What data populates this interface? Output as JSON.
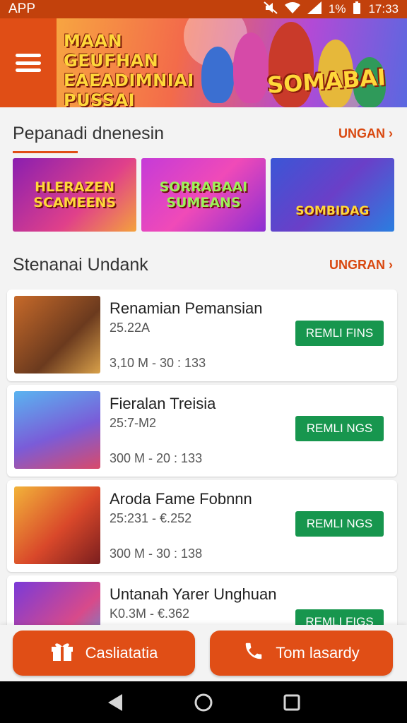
{
  "status_bar": {
    "app_label": "APP",
    "time": "17:33",
    "battery_text": "1%"
  },
  "hero": {
    "title": "MAAN GEUFHAN EAEADIMNIAI PUSSAI TACR!!",
    "logo": "SOMABAI"
  },
  "section1": {
    "title": "Pepanadi dnenesin",
    "link": "UNGAN",
    "cards": [
      {
        "label": "HLERAZEN SCAMEENS"
      },
      {
        "label": "SORRABAAI SUMEANS"
      },
      {
        "label": "SOMBIDAG"
      }
    ]
  },
  "section2": {
    "title": "Stenanai Undank",
    "link": "UNGRAN"
  },
  "list": [
    {
      "title": "Renamian Pemansian",
      "subtitle": "25.22A",
      "meta": "3,10 M - 30 : 133",
      "button": "REMLI FINS"
    },
    {
      "title": "Fieralan Treisia",
      "subtitle": "25:7-M2",
      "meta": "300 M - 20 : 133",
      "button": "REMLI NGS"
    },
    {
      "title": "Aroda Fame Fobnnn",
      "subtitle": "25:231 - €.252",
      "meta": "300 M - 30 : 138",
      "button": "REMLI NGS"
    },
    {
      "title": "Untanah Yarer Unghuan",
      "subtitle": "K0.3M - €.362",
      "meta": "",
      "button": "REMLI FIGS"
    }
  ],
  "actions": {
    "left": "Casliatatia",
    "right": "Tom lasardy"
  },
  "icons": {
    "menu": "hamburger-menu-icon",
    "chevron": "chevron-right-icon",
    "gift": "gift-icon",
    "phone": "phone-icon",
    "back": "back-triangle-icon",
    "home": "home-circle-icon",
    "recents": "recents-square-icon"
  },
  "colors": {
    "primary": "#e04e16",
    "accent_green": "#17964e",
    "status_bar": "#c2410c"
  }
}
